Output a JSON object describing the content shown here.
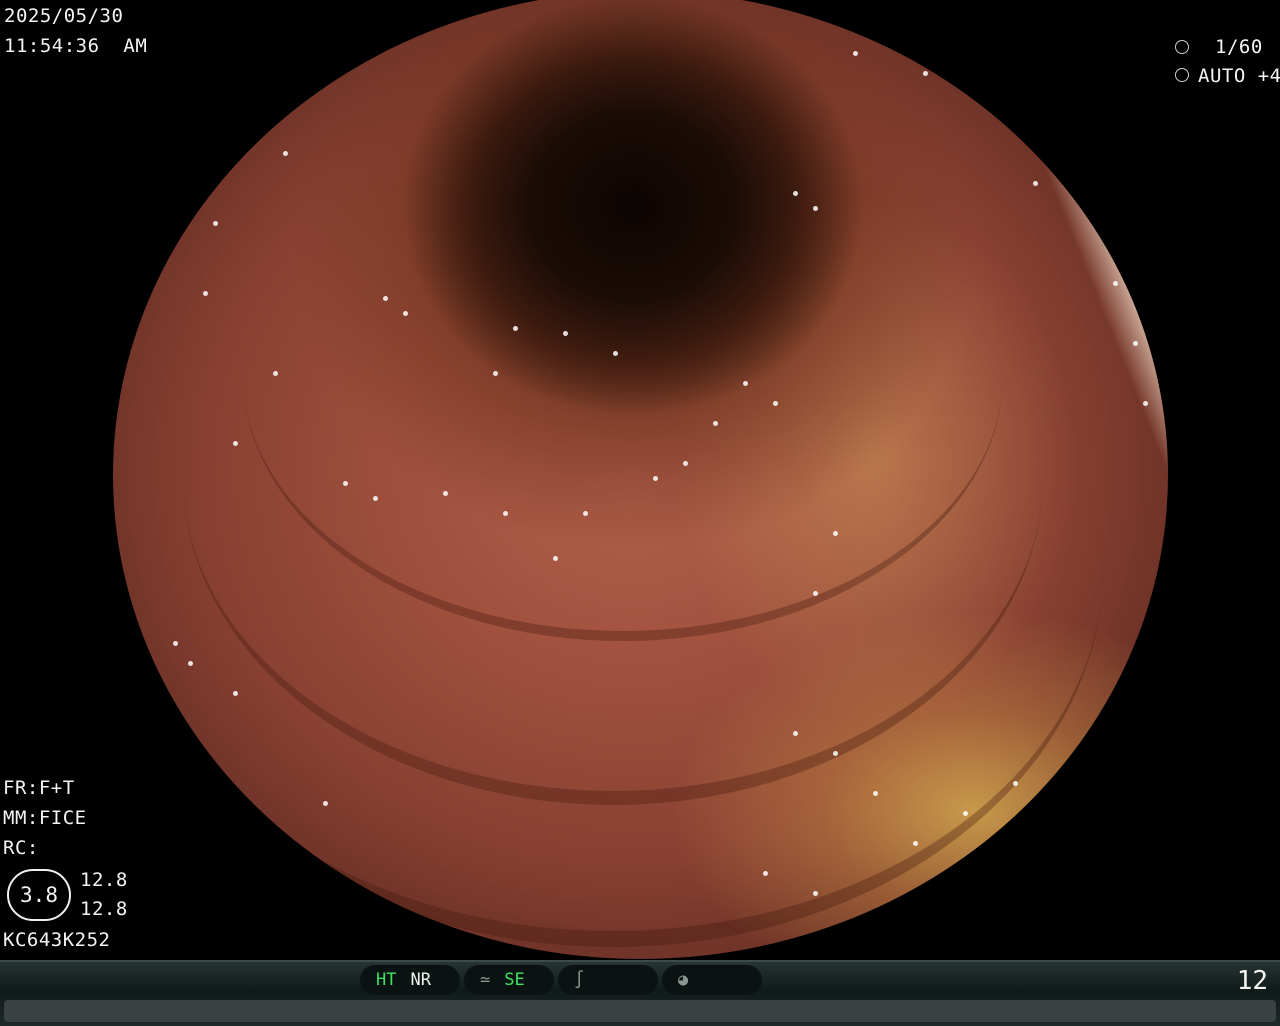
{
  "header": {
    "date": "2025/05/30",
    "time": "11:54:36  AM"
  },
  "exposure": {
    "shutter_icon": "shutter-icon",
    "shutter_speed": "1/60",
    "iris_icon": "iris-icon",
    "iris_mode": "AUTO +4"
  },
  "settings": {
    "fr": "FR:F+T",
    "mm": "MM:FICE",
    "rc": "RC:",
    "zoom": "3.8",
    "value_top": "12.8",
    "value_bottom": "12.8",
    "scope_id": "KC643K252"
  },
  "status_bar": {
    "ht": "HT",
    "nr": "NR",
    "wave_icon": "wave-icon",
    "se": "SE",
    "curve_icon": "curve-icon",
    "gauge_icon": "gauge-icon",
    "page": "12"
  },
  "colors": {
    "active_mode": "#3fe064",
    "bar_bg": "#101a19"
  }
}
